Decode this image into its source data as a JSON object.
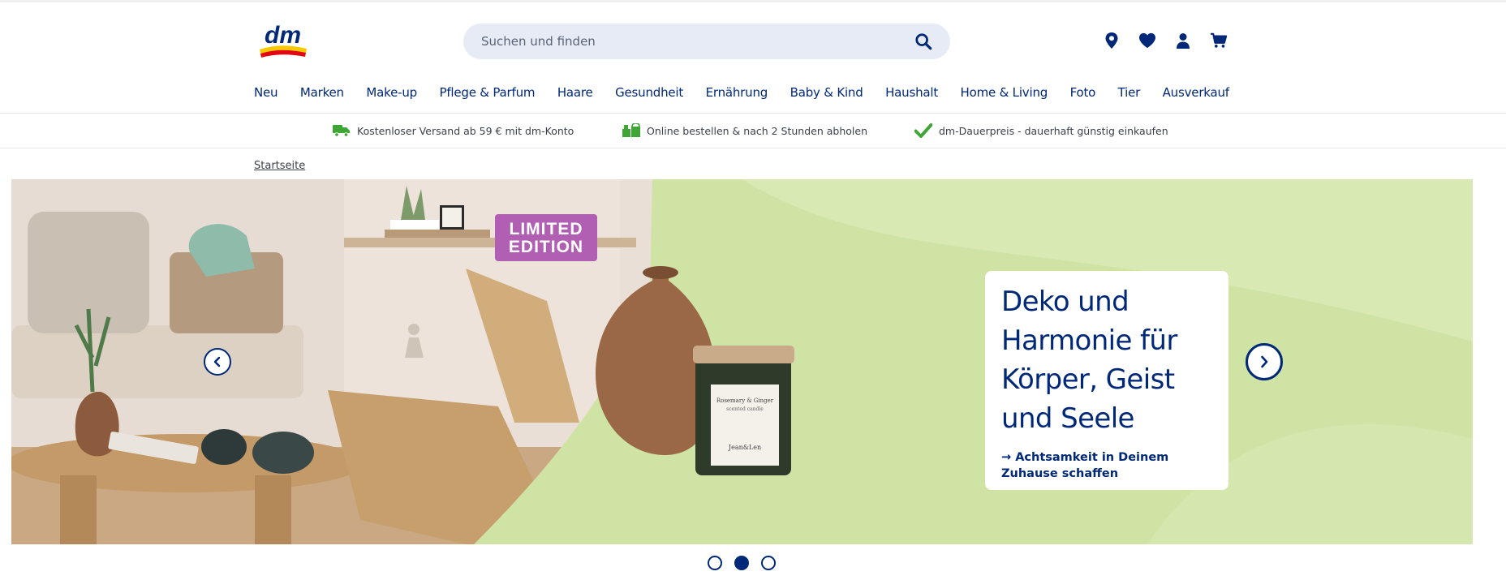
{
  "header": {
    "logo_text": "dm",
    "search": {
      "placeholder": "Suchen und finden"
    },
    "icons": [
      "location-pin-icon",
      "heart-icon",
      "user-icon",
      "cart-icon"
    ]
  },
  "nav": {
    "items": [
      "Neu",
      "Marken",
      "Make-up",
      "Pflege & Parfum",
      "Haare",
      "Gesundheit",
      "Ernährung",
      "Baby & Kind",
      "Haushalt",
      "Home & Living",
      "Foto",
      "Tier",
      "Ausverkauf"
    ]
  },
  "usp": [
    {
      "icon": "delivery-truck-icon",
      "text": "Kostenloser Versand ab 59 € mit dm-Konto"
    },
    {
      "icon": "store-pickup-icon",
      "text": "Online bestellen & nach 2 Stunden abholen"
    },
    {
      "icon": "checkmark-icon",
      "text": "dm-Dauerpreis - dauerhaft günstig einkaufen"
    }
  ],
  "breadcrumb": {
    "home": "Startseite"
  },
  "hero": {
    "badge_line1": "LIMITED",
    "badge_line2": "EDITION",
    "headline": "Deko und Harmonie für Körper, Geist und Seele",
    "cta": "→ Achtsamkeit in Deinem Zuhause schaffen",
    "candle_label_line1": "Rosemary & Ginger",
    "candle_label_line2": "scented candle",
    "candle_brand": "Jean&Len"
  },
  "carousel": {
    "slides": 3,
    "active_index": 1
  },
  "colors": {
    "brand_blue": "#002878",
    "search_bg": "#e6ebf5",
    "usp_green": "#3fa535",
    "hero_green": "#cfe3a4",
    "badge_purple": "#b05fb3",
    "logo_yellow": "#f9c900",
    "logo_red": "#e30613"
  }
}
